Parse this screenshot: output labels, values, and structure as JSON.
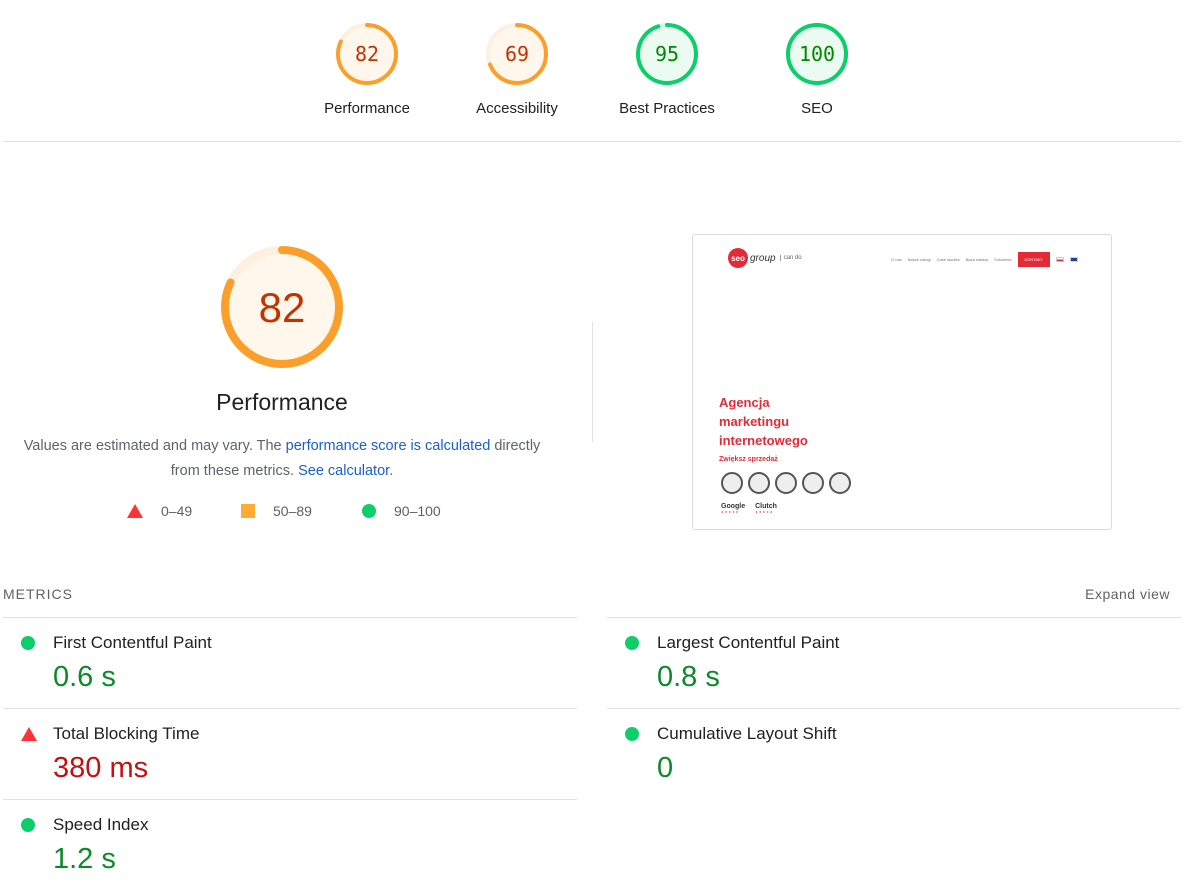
{
  "gauges": [
    {
      "label": "Performance",
      "score": "82",
      "value": 0.82,
      "color": "#fa9f2b",
      "track": "#fdf0e0",
      "text": "#c33300",
      "fill": "#fff6ec"
    },
    {
      "label": "Accessibility",
      "score": "69",
      "value": 0.69,
      "color": "#fa9f2b",
      "track": "#fdf0e0",
      "text": "#c33300",
      "fill": "#fff6ec"
    },
    {
      "label": "Best Practices",
      "score": "95",
      "value": 0.95,
      "color": "#0cce6b",
      "track": "#d6f5e3",
      "text": "#008800",
      "fill": "#ebfbf1"
    },
    {
      "label": "SEO",
      "score": "100",
      "value": 1.0,
      "color": "#0cce6b",
      "track": "#d6f5e3",
      "text": "#008800",
      "fill": "#ebfbf1"
    }
  ],
  "performance": {
    "score": "82",
    "value": 0.82,
    "title": "Performance",
    "desc_prefix": "Values are estimated and may vary. The ",
    "desc_link1": "performance score is calculated",
    "desc_middle": " directly from these metrics. ",
    "desc_link2": "See calculator",
    "desc_suffix": "."
  },
  "legend": [
    {
      "shape": "triangle",
      "label": "0–49",
      "color": "#ff3333"
    },
    {
      "shape": "square",
      "label": "50–89",
      "color": "#ffaa33"
    },
    {
      "shape": "circle",
      "label": "90–100",
      "color": "#0cce6b"
    }
  ],
  "thumbnail": {
    "logo_seo": "seo",
    "logo_group": "group",
    "logo_can": "can do",
    "nav": [
      "O nas",
      "Nasze usługi",
      "Case studies",
      "Baza wiedzy",
      "Szkolenia"
    ],
    "kontakt": "KONTAKT",
    "headline": [
      "Agencja",
      "marketingu",
      "internetowego"
    ],
    "subline": "Zwiększ sprzedaż",
    "reviews": [
      "Google",
      "Clutch"
    ],
    "review_stars": "★★★★★"
  },
  "metrics": {
    "header": "METRICS",
    "expand": "Expand view",
    "left": [
      {
        "name": "First Contentful Paint",
        "value": "0.6 s",
        "status": "good"
      },
      {
        "name": "Total Blocking Time",
        "value": "380 ms",
        "status": "bad"
      },
      {
        "name": "Speed Index",
        "value": "1.2 s",
        "status": "good"
      }
    ],
    "right": [
      {
        "name": "Largest Contentful Paint",
        "value": "0.8 s",
        "status": "good"
      },
      {
        "name": "Cumulative Layout Shift",
        "value": "0",
        "status": "good"
      }
    ]
  }
}
